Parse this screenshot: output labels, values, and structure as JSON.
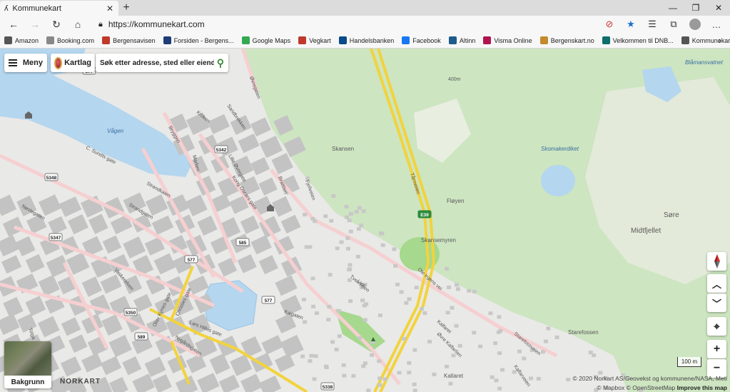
{
  "browser": {
    "tab_title": "Kommunekart",
    "url": "https://kommunekart.com",
    "bookmarks": [
      {
        "label": "Amazon",
        "color": "#555"
      },
      {
        "label": "Booking.com",
        "color": "#888"
      },
      {
        "label": "Bergensavisen",
        "color": "#c0392b"
      },
      {
        "label": "Forsiden - Bergens...",
        "color": "#1f3c78"
      },
      {
        "label": "Google Maps",
        "color": "#34a853"
      },
      {
        "label": "Vegkart",
        "color": "#c0392b"
      },
      {
        "label": "Handelsbanken",
        "color": "#0a4a8a"
      },
      {
        "label": "Facebook",
        "color": "#1877f2"
      },
      {
        "label": "Altinn",
        "color": "#1c5b8a"
      },
      {
        "label": "Visma Online",
        "color": "#b1134e"
      },
      {
        "label": "Bergenskart.no",
        "color": "#c48a2e"
      },
      {
        "label": "Velkommen til DNB...",
        "color": "#0f6d6d"
      },
      {
        "label": "Kommunekart",
        "color": "#555"
      }
    ]
  },
  "toolbar": {
    "menu_label": "Meny",
    "layers_label": "Kartlag",
    "search_placeholder": "Søk etter adresse, sted eller eiendom"
  },
  "map": {
    "place_labels": [
      "Vågen",
      "Skansen",
      "Fløyen",
      "Skansemyren",
      "Skomakerdiket",
      "Søre",
      "Midtfjellet",
      "Starefossen",
      "Blåmansvatnet",
      "Kallaret",
      "400m"
    ],
    "street_labels": [
      "Sandbrekken",
      "Øvregaten",
      "Bryggen",
      "Kroken",
      "Lille Øvregate",
      "C. Sundts gate",
      "Strandgaten",
      "Strandkaien",
      "Nøstegaten",
      "Marken",
      "Kong Oscars gate",
      "Vaskerelven",
      "Olav Kyrres gate",
      "Christies gate",
      "Lars Hilles gate",
      "Nygårdsgaten",
      "Fjellveien",
      "Ole Irgens vei",
      "Kalfaret",
      "Tårnveien",
      "Tverrveien",
      "Starefossveien",
      "Kalfarveien",
      "Brattlien",
      "Lien",
      "Tolga",
      "Kaigaten",
      "Øvre Kalfarlien"
    ],
    "route_labels": [
      "577",
      "5342",
      "5348",
      "5347",
      "585",
      "5350",
      "589",
      "5338",
      "E39"
    ]
  },
  "controls": {
    "background_label": "Bakgrunn",
    "logo": "NORKART",
    "scale_label": "100 m",
    "attribution_line1": "© 2020 Norkart AS/Geovekst og kommunene/NASA, Meti",
    "attribution_line2": "© Mapbox © OpenStreetMap",
    "improve_link": "Improve this map"
  },
  "colors": {
    "land": "#e9e9e7",
    "water": "#b4d6ef",
    "forest": "#cde5c1",
    "road_main": "#f2d33d",
    "road_secondary": "#f6cfd1",
    "building": "#c3c3c3",
    "park": "#a6d88d"
  }
}
